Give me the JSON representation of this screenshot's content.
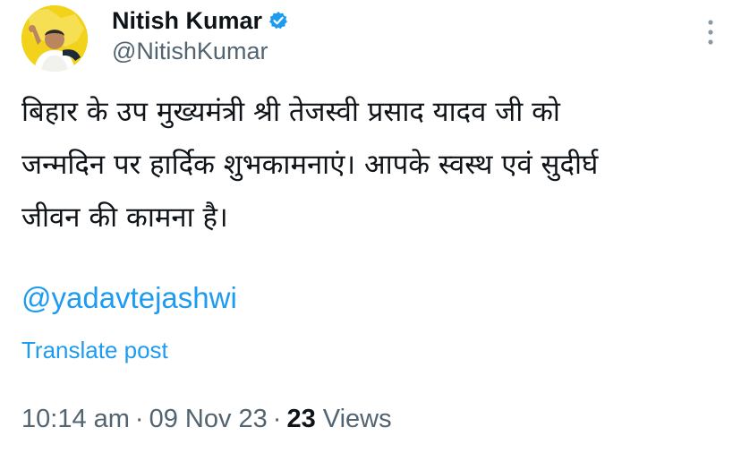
{
  "author": {
    "display_name": "Nitish Kumar",
    "handle": "@NitishKumar",
    "verified_icon": "verified-badge-icon",
    "avatar_icon": "avatar-photo"
  },
  "tweet": {
    "text_lines": [
      "बिहार के उप मुख्यमंत्री श्री तेजस्वी प्रसाद यादव जी को",
      "जन्मदिन पर हार्दिक शुभकामनाएं। आपके स्वस्थ एवं सुदीर्घ",
      "जीवन की कामना है।"
    ],
    "mention": "@yadavtejashwi",
    "translate_label": "Translate post"
  },
  "meta": {
    "time": "10:14 am",
    "separator": "·",
    "date": "09 Nov 23",
    "views_count": "23",
    "views_label": "Views"
  },
  "colors": {
    "link": "#1d9bf0",
    "secondary_text": "#536471",
    "avatar_bg": "#f2d21b"
  },
  "icons": {
    "more": "more-vertical-icon"
  }
}
